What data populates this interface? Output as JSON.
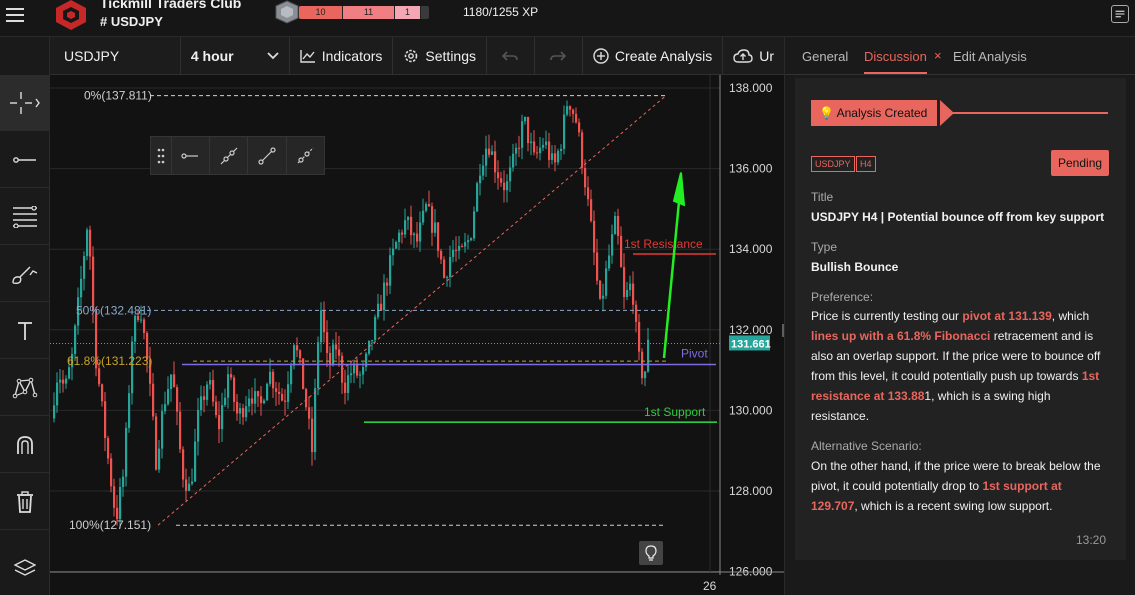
{
  "header": {
    "club_title": "Tickmill Traders Club",
    "symbol": "USDJPY",
    "xp_segments": [
      "10",
      "11",
      "1"
    ],
    "xp_text": "1180/1255 XP"
  },
  "toolbar": {
    "symbol": "USDJPY",
    "interval": "4 hour",
    "indicators": "Indicators",
    "settings": "Settings",
    "create_analysis": "Create Analysis",
    "upload_partial": "Ur"
  },
  "chart": {
    "price_axis": [
      "138.000",
      "136.000",
      "134.000",
      "132.000",
      "130.000",
      "128.000",
      "126.000"
    ],
    "date_label": "26",
    "current_price": "131.661",
    "fib_levels": [
      "0%(137.811)",
      "50%(132.481)",
      "61.8%(131.223)",
      "100%(127.151)"
    ],
    "line_labels": {
      "resistance": "1st Resistance",
      "pivot": "Pivot",
      "support": "1st Support"
    },
    "colors": {
      "up": "#26a69a",
      "down": "#ef5350",
      "resistance": "#e53935",
      "pivot": "#7e6be0",
      "support": "#2ecc40",
      "arrow": "#22ee22",
      "accent": "#e8665d"
    }
  },
  "panel": {
    "tabs": [
      "General",
      "Discussion",
      "Edit Analysis"
    ],
    "active_tab": "Discussion",
    "created_label": "Analysis Created",
    "tags": [
      "USDJPY",
      "H4"
    ],
    "status": "Pending",
    "title_label": "Title",
    "title_value": "USDJPY H4 | Potential bounce off from key support",
    "type_label": "Type",
    "type_value": "Bullish Bounce",
    "preference_label": "Preference:",
    "preference_text": [
      {
        "t": "Price is currently testing our ",
        "h": false
      },
      {
        "t": "pivot at 131.139",
        "h": true
      },
      {
        "t": ", which ",
        "h": false
      },
      {
        "t": "lines up with a 61.8% Fibonacci",
        "h": true
      },
      {
        "t": " retracement and is also an overlap support. If the price were to bounce off from this level, it could potentially push up towards ",
        "h": false
      },
      {
        "t": "1st resistance at 133.88",
        "h": true
      },
      {
        "t": "1, which is a swing high resistance.",
        "h": false
      }
    ],
    "alt_label": "Alternative Scenario:",
    "alt_text": [
      {
        "t": "On the other hand, if the price were to break below the pivot, it could potentially drop to ",
        "h": false
      },
      {
        "t": "1st support at 129.707",
        "h": true
      },
      {
        "t": ", which is a recent swing low support.",
        "h": false
      }
    ],
    "time": "13:20"
  },
  "icons": {
    "rail": [
      "crosshair-icon",
      "horizontal-line-icon",
      "fib-retracement-icon",
      "brush-icon",
      "text-icon",
      "pattern-icon",
      "magnet-icon",
      "trash-icon",
      "layers-icon"
    ],
    "drawing_toolbar": [
      "horizontal-ray-icon",
      "extended-line-icon",
      "trend-line-icon",
      "ray-icon"
    ]
  }
}
